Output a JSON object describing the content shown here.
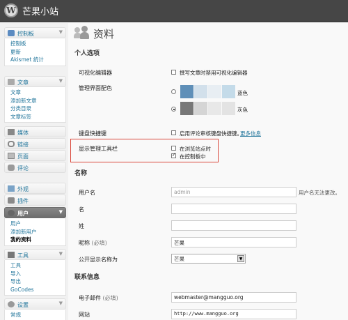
{
  "header": {
    "site_title": "芒果小站",
    "logo_letter": "W"
  },
  "sidebar": {
    "dashboard": {
      "label": "控制板",
      "items": [
        "控制板",
        "更新",
        "Akismet 统计"
      ]
    },
    "posts": {
      "label": "文章",
      "items": [
        "文章",
        "添加新文章",
        "分类目录",
        "文章标签"
      ]
    },
    "media": {
      "label": "媒体"
    },
    "links": {
      "label": "链接"
    },
    "pages": {
      "label": "页面"
    },
    "comments": {
      "label": "评论"
    },
    "appearance": {
      "label": "外观"
    },
    "plugins": {
      "label": "插件"
    },
    "users": {
      "label": "用户",
      "items": [
        "用户",
        "添加新用户",
        "我的资料"
      ]
    },
    "tools": {
      "label": "工具",
      "items": [
        "工具",
        "导入",
        "导出",
        "GoCodes"
      ]
    },
    "settings": {
      "label": "设置",
      "items": [
        "常规"
      ]
    }
  },
  "page": {
    "title": "资料"
  },
  "personal": {
    "section": "个人选项",
    "visual_editor": {
      "label": "可视化编辑器",
      "option": "撰写文章时禁用可视化编辑器",
      "checked": false
    },
    "color_scheme": {
      "label": "管理界面配色",
      "options": [
        {
          "name": "蓝色",
          "selected": false,
          "colors": [
            "#5f8fb8",
            "#d2e0eb",
            "#e8eef3",
            "#c4dbe9"
          ]
        },
        {
          "name": "灰色",
          "selected": true,
          "colors": [
            "#787878",
            "#d5d5d5",
            "#e8e8e8",
            "#e3e3e3"
          ]
        }
      ]
    },
    "keyboard": {
      "label": "键盘快捷键",
      "option": "启用评论审核键盘快捷键。",
      "link": "更多信息",
      "checked": false
    },
    "toolbar": {
      "label": "显示管理工具栏",
      "options": [
        {
          "text": "在浏览站点时",
          "checked": false
        },
        {
          "text": "在控制板中",
          "checked": true
        }
      ]
    }
  },
  "name": {
    "section": "名称",
    "username": {
      "label": "用户名",
      "value": "admin",
      "note": "用户名无法更改。"
    },
    "first_name": {
      "label": "名",
      "value": ""
    },
    "last_name": {
      "label": "姓",
      "value": ""
    },
    "nickname": {
      "label": "昵称",
      "required": "(必填)",
      "value": "芒果"
    },
    "display_name": {
      "label": "公开显示名称为",
      "value": "芒果"
    }
  },
  "contact": {
    "section": "联系信息",
    "email": {
      "label": "电子邮件",
      "required": "(必填)",
      "value": "webmaster@mangguo.org"
    },
    "website": {
      "label": "网站",
      "value": "http://www.mangguo.org"
    }
  }
}
